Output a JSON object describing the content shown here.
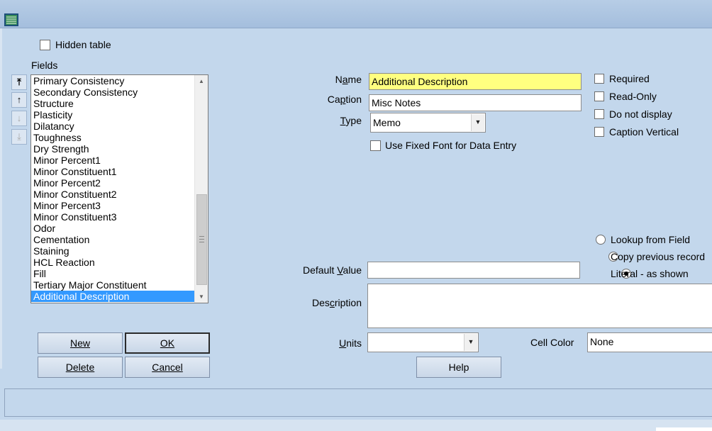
{
  "window": {
    "title": ""
  },
  "hidden_table": {
    "label": "Hidden table",
    "checked": false
  },
  "fields": {
    "label": "Fields",
    "items": [
      "Primary Consistency",
      "Secondary Consistency",
      "Structure",
      "Plasticity",
      "Dilatancy",
      "Toughness",
      "Dry Strength",
      "Minor Percent1",
      "Minor Constituent1",
      "Minor Percent2",
      "Minor Constituent2",
      "Minor Percent3",
      "Minor Constituent3",
      "Odor",
      "Cementation",
      "Staining",
      "HCL Reaction",
      "Fill",
      "Tertiary Major Constituent",
      "Additional Description"
    ],
    "selected": "Additional Description"
  },
  "buttons": {
    "new": "New",
    "ok": "OK",
    "delete": "Delete",
    "cancel": "Cancel",
    "help": "Help"
  },
  "form": {
    "name_label_pre": "N",
    "name_label_u": "a",
    "name_label_post": "me",
    "name_value": "Additional Description",
    "caption_label_pre": "Ca",
    "caption_label_u": "p",
    "caption_label_post": "tion",
    "caption_value": "Misc Notes",
    "type_label_u": "T",
    "type_label_post": "ype",
    "type_value": "Memo",
    "fixed_font_label": "Use Fixed Font for Data Entry",
    "default_label_pre": "Default ",
    "default_label_u": "V",
    "default_label_post": "alue",
    "default_value": "",
    "description_label_pre": "Des",
    "description_label_u": "c",
    "description_label_post": "ription",
    "description_value": "",
    "units_label_u": "U",
    "units_label_post": "nits",
    "units_value": "",
    "cell_color_label": "Cell Color",
    "cell_color_value": "None"
  },
  "options": {
    "required": "Required",
    "read_only": "Read-Only",
    "do_not_display": "Do not display",
    "caption_vertical": "Caption Vertical"
  },
  "default_source": {
    "lookup": "Lookup from Field",
    "copy_previous": "Copy previous record",
    "literal": "Literal - as shown",
    "selected": "literal"
  },
  "colors": {
    "background": "#c3d7ec",
    "selection": "#3399ff",
    "name_field": "#ffff80"
  }
}
